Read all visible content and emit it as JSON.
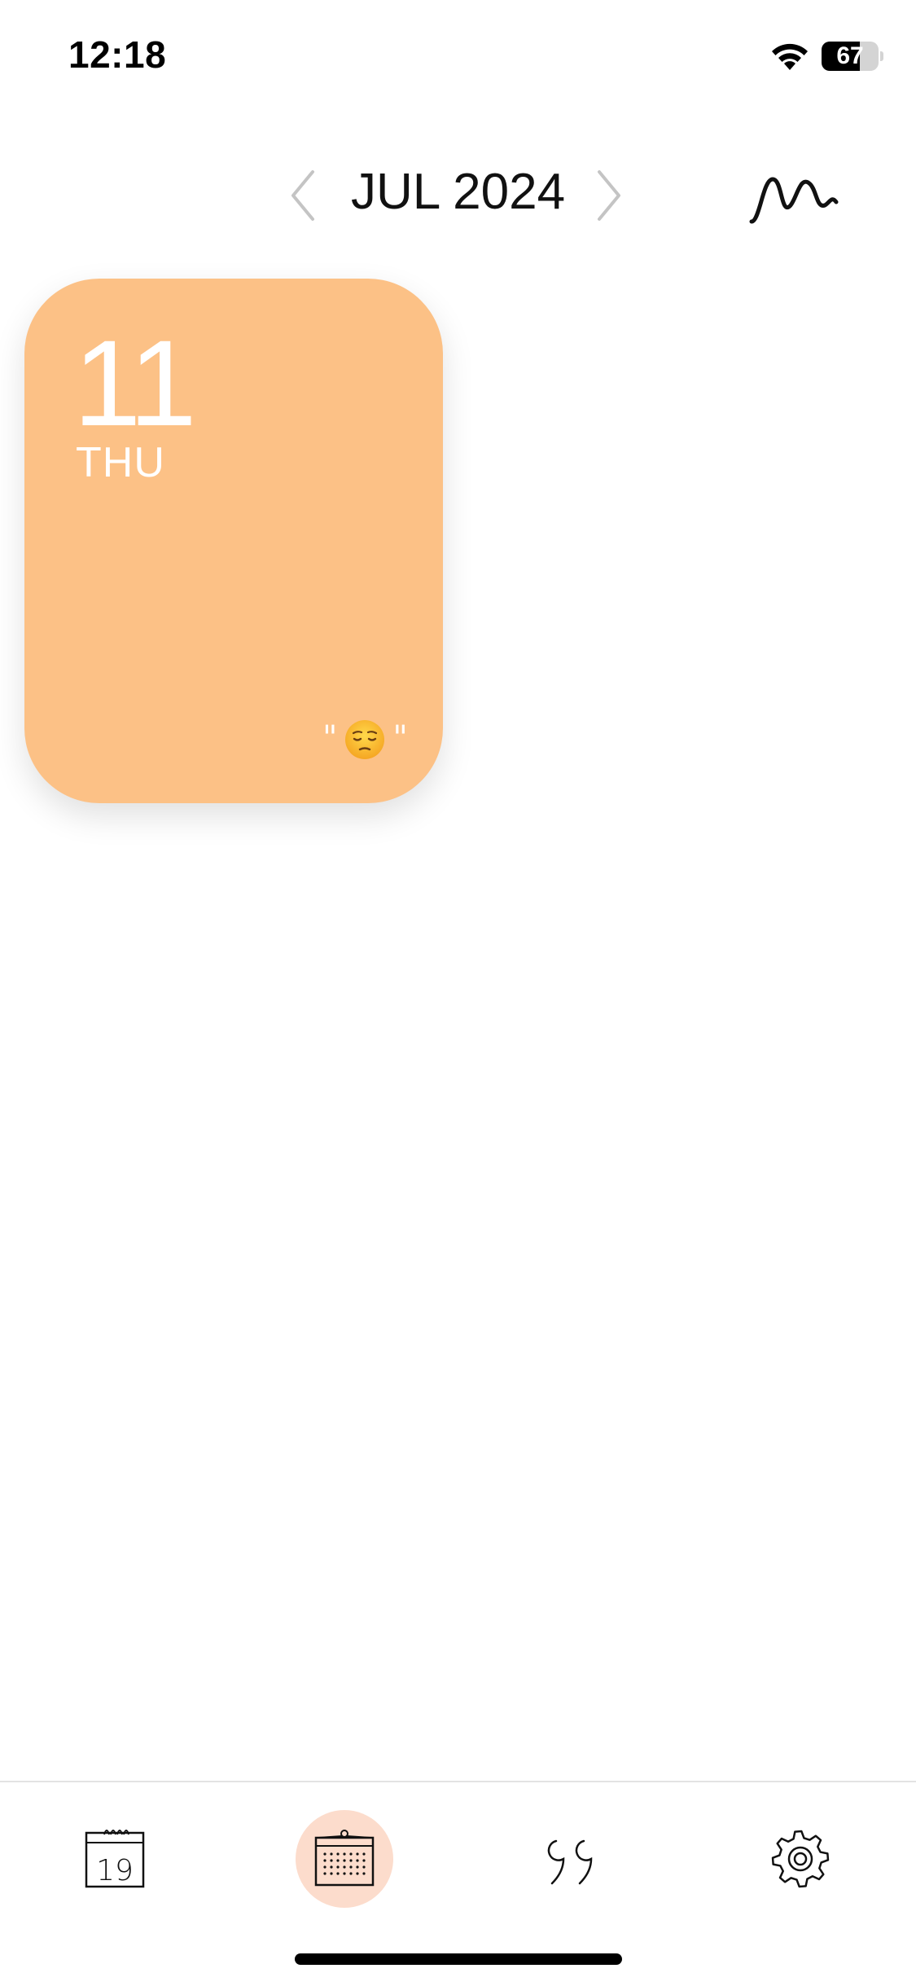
{
  "status_bar": {
    "time": "12:18",
    "battery_level": "67",
    "battery_fraction": 0.67,
    "wifi_icon": "wifi-icon"
  },
  "header": {
    "month_label": "JUL 2024",
    "prev_icon": "chevron-left-icon",
    "next_icon": "chevron-right-icon",
    "trend_icon": "wave-icon"
  },
  "entries": [
    {
      "day": "11",
      "weekday": "THU",
      "mood_icon": "pensive-face-icon",
      "color": "#fcc186"
    }
  ],
  "tab_bar": {
    "tabs": [
      {
        "id": "daily",
        "icon": "calendar-day-icon",
        "icon_text": "19",
        "active": false
      },
      {
        "id": "monthly",
        "icon": "calendar-grid-icon",
        "active": true
      },
      {
        "id": "quotes",
        "icon": "quote-icon",
        "active": false
      },
      {
        "id": "settings",
        "icon": "gear-icon",
        "active": false
      }
    ],
    "active_color": "#fcdccc"
  }
}
